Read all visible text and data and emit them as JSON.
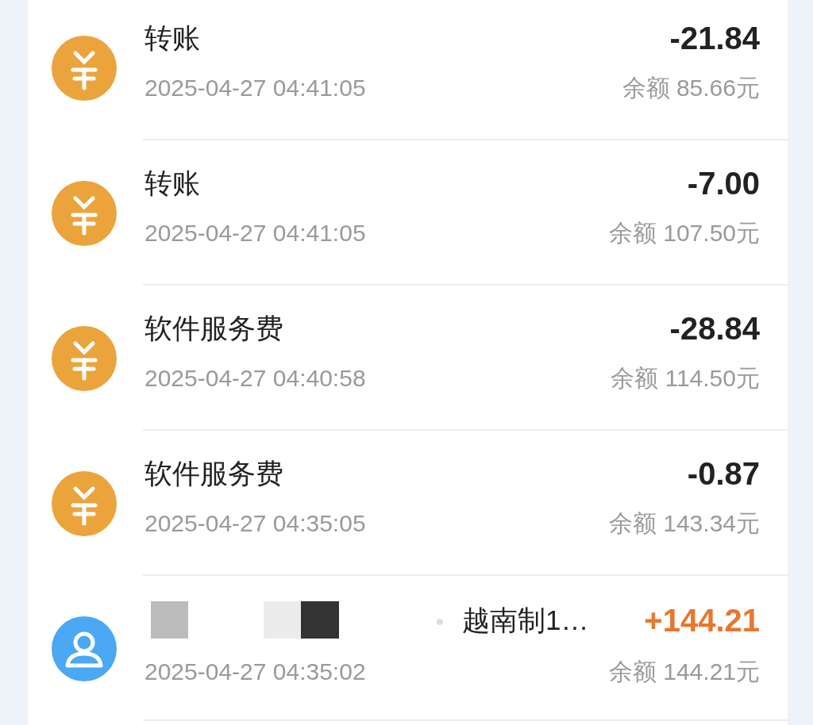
{
  "transactions": [
    {
      "kind": "expense",
      "title": "转账",
      "amount": "-21.84",
      "time": "2025-04-27 04:41:05",
      "balance": "余额 85.66元"
    },
    {
      "kind": "expense",
      "title": "转账",
      "amount": "-7.00",
      "time": "2025-04-27 04:41:05",
      "balance": "余额 107.50元"
    },
    {
      "kind": "expense",
      "title": "软件服务费",
      "amount": "-28.84",
      "time": "2025-04-27 04:40:58",
      "balance": "余额 114.50元"
    },
    {
      "kind": "expense",
      "title": "软件服务费",
      "amount": "-0.87",
      "time": "2025-04-27 04:35:05",
      "balance": "余额 143.34元"
    },
    {
      "kind": "income",
      "redacted": true,
      "title": "越南制1…",
      "amount": "+144.21",
      "time": "2025-04-27 04:35:02",
      "balance": "余额 144.21元"
    }
  ]
}
